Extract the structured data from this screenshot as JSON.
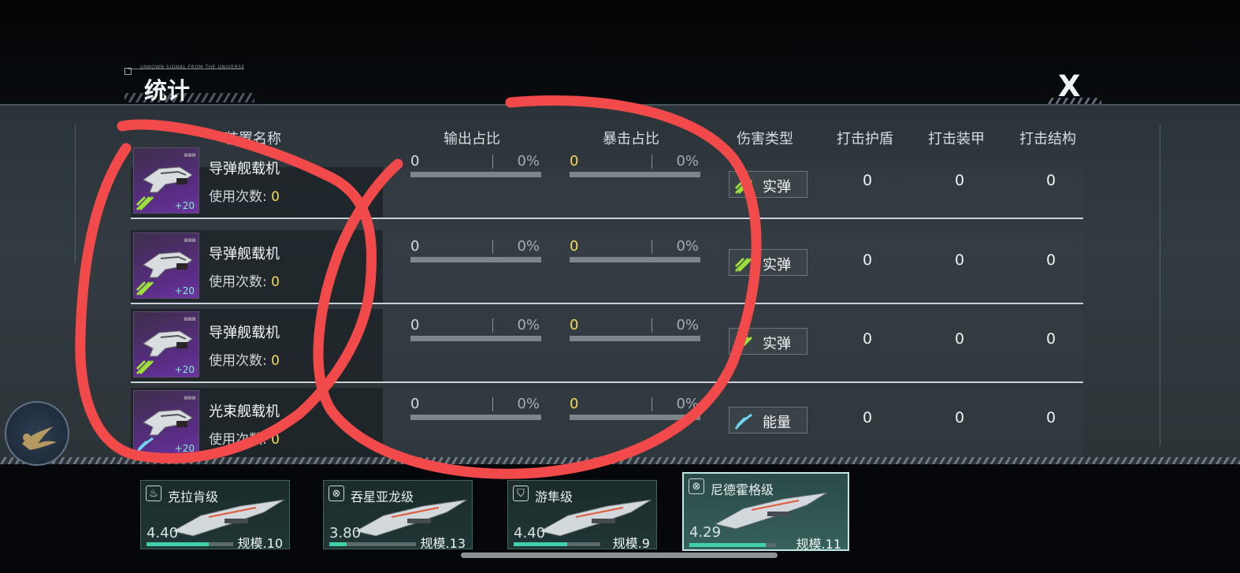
{
  "header": {
    "deco_text": "UNKOWN SIGNAL FROM THE UNIVERSE",
    "title": "统计",
    "close_label": "X"
  },
  "table": {
    "columns": {
      "device_name": "装置名称",
      "output_ratio": "输出占比",
      "crit_ratio": "暴击占比",
      "damage_type": "伤害类型",
      "hit_shield": "打击护盾",
      "hit_armor": "打击装甲",
      "hit_structure": "打击结构"
    },
    "rows": [
      {
        "name": "导弹舰载机",
        "uses_label": "使用次数:",
        "uses": "0",
        "plus": "+20",
        "output": "0",
        "output_pct": "0%",
        "output_fill": 0,
        "crit": "0",
        "crit_pct": "0%",
        "crit_fill": 0,
        "damage_type": "实弹",
        "damage_icon": "kinetic-icon",
        "shield": "0",
        "armor": "0",
        "structure": "0"
      },
      {
        "name": "导弹舰载机",
        "uses_label": "使用次数:",
        "uses": "0",
        "plus": "+20",
        "output": "0",
        "output_pct": "0%",
        "output_fill": 0,
        "crit": "0",
        "crit_pct": "0%",
        "crit_fill": 0,
        "damage_type": "实弹",
        "damage_icon": "kinetic-icon",
        "shield": "0",
        "armor": "0",
        "structure": "0"
      },
      {
        "name": "导弹舰载机",
        "uses_label": "使用次数:",
        "uses": "0",
        "plus": "+20",
        "output": "0",
        "output_pct": "0%",
        "output_fill": 0,
        "crit": "0",
        "crit_pct": "0%",
        "crit_fill": 0,
        "damage_type": "实弹",
        "damage_icon": "kinetic-icon",
        "shield": "0",
        "armor": "0",
        "structure": "0"
      },
      {
        "name": "光束舰载机",
        "uses_label": "使用次数:",
        "uses": "0",
        "plus": "+20",
        "output": "0",
        "output_pct": "0%",
        "output_fill": 0,
        "crit": "0",
        "crit_pct": "0%",
        "crit_fill": 0,
        "damage_type": "能量",
        "damage_icon": "energy-icon",
        "shield": "0",
        "armor": "0",
        "structure": "0"
      }
    ]
  },
  "fleet": [
    {
      "name": "克拉肯级",
      "icon": "cruiser-icon",
      "power": "4.40",
      "scale": "规模.10",
      "fill": 0.72
    },
    {
      "name": "吞星亚龙级",
      "icon": "carrier-icon",
      "power": "3.80",
      "scale": "规模.13",
      "fill": 0.2
    },
    {
      "name": "游隼级",
      "icon": "shield-icon",
      "power": "4.40",
      "scale": "规模.9",
      "fill": 0.62
    },
    {
      "name": "尼德霍格级",
      "icon": "carrier-icon",
      "power": "4.29",
      "scale": "规模.11",
      "fill": 0.88,
      "active": true
    }
  ],
  "colors": {
    "accent_yellow": "#f4d85a",
    "fleet_bar": "#3fd0a8",
    "annotation_red": "#f24a4a"
  }
}
